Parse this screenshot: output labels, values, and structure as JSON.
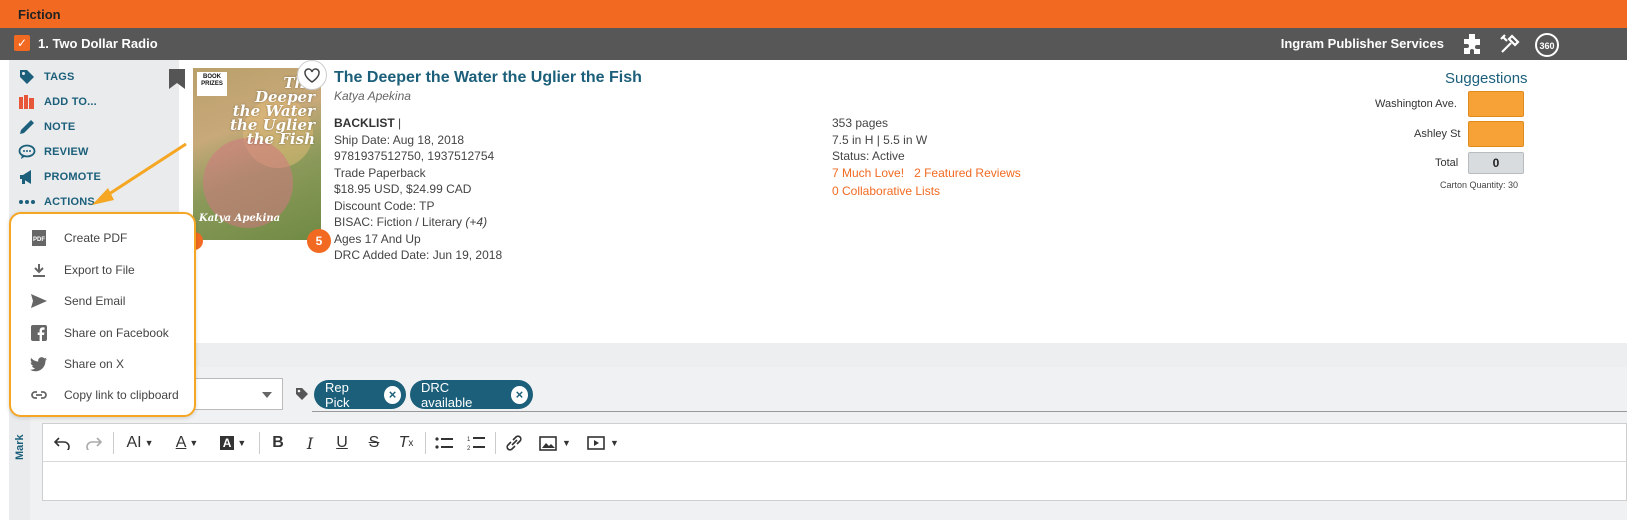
{
  "category": "Fiction",
  "publisher": {
    "name": "1. Two Dollar Radio",
    "distributor": "Ingram Publisher Services"
  },
  "sidebar_actions": [
    {
      "label": "TAGS",
      "icon": "tag-icon"
    },
    {
      "label": "ADD TO...",
      "icon": "books-icon"
    },
    {
      "label": "NOTE",
      "icon": "pencil-icon"
    },
    {
      "label": "REVIEW",
      "icon": "speech-bubble-icon"
    },
    {
      "label": "PROMOTE",
      "icon": "megaphone-icon"
    },
    {
      "label": "ACTIONS",
      "icon": "ellipsis-icon"
    }
  ],
  "actions_menu": [
    {
      "label": "Create PDF",
      "icon": "pdf-icon"
    },
    {
      "label": "Export to File",
      "icon": "download-icon"
    },
    {
      "label": "Send Email",
      "icon": "send-icon"
    },
    {
      "label": "Share on Facebook",
      "icon": "facebook-icon"
    },
    {
      "label": "Share on X",
      "icon": "twitter-icon"
    },
    {
      "label": "Copy link to clipboard",
      "icon": "link-icon"
    }
  ],
  "book": {
    "title": "The Deeper the Water the Uglier the Fish",
    "author": "Katya Apekina",
    "cover_title": "The Deeper the Water the Uglier the Fish",
    "cover_author": "Katya Apekina",
    "cover_badge": "BOOK PRIZES",
    "status_tag": "BACKLIST",
    "status_sep": " |",
    "ship_date": "Ship Date: Aug 18, 2018",
    "isbns": "9781937512750, 1937512754",
    "format": "Trade Paperback",
    "price": "$18.95 USD, $24.99 CAD",
    "discount": "Discount Code: TP",
    "bisac": "BISAC: Fiction / Literary",
    "bisac_more": "(+4)",
    "ages": "Ages 17 And Up",
    "drc_date": "DRC Added Date: Jun 19, 2018",
    "pages": "353 pages",
    "dimensions": "7.5 in H | 5.5 in W",
    "status": "Status: Active",
    "much_love": "7 Much Love!",
    "featured_reviews": "2 Featured Reviews",
    "collab_lists": "0 Collaborative Lists",
    "badge_number": "5"
  },
  "suggestions": {
    "title": "Suggestions",
    "rows": [
      {
        "label": "Washington Ave."
      },
      {
        "label": "Ashley St"
      }
    ],
    "total_label": "Total",
    "total_value": "0",
    "carton": "Carton Quantity: 30"
  },
  "tags": [
    "Rep Pick",
    "DRC available"
  ],
  "side_marker": "Mark",
  "colors": {
    "accent": "#f26a21",
    "brand": "#1b5f7a",
    "highlight": "#f5a623"
  }
}
